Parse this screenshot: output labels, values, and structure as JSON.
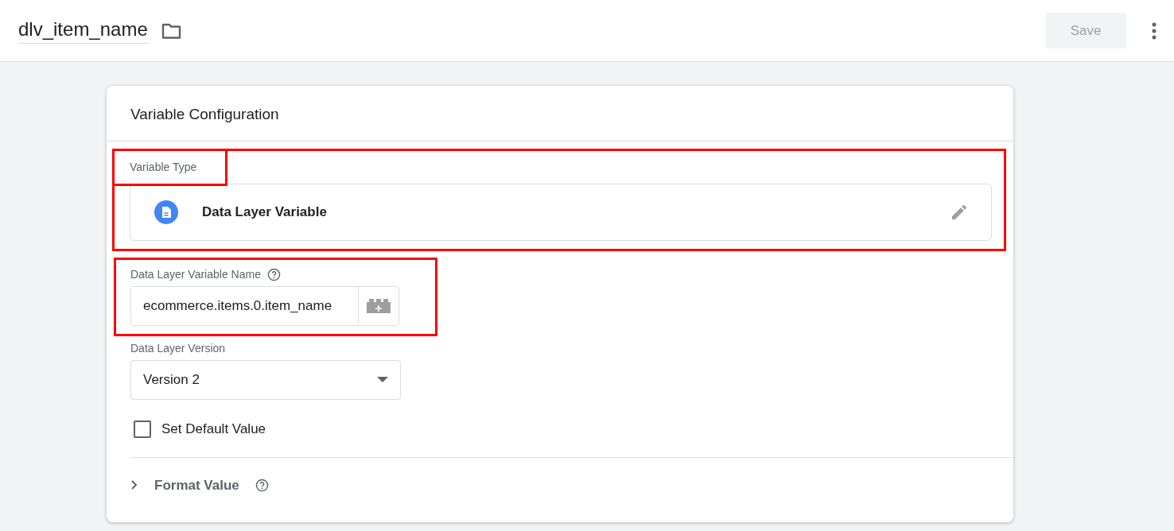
{
  "header": {
    "title": "dlv_item_name",
    "save_button": {
      "label": "Save",
      "disabled": true
    }
  },
  "card": {
    "title": "Variable Configuration"
  },
  "variable_type": {
    "label": "Variable Type",
    "value": "Data Layer Variable",
    "highlighted": true,
    "label_highlighted": true
  },
  "variable_name": {
    "label": "Data Layer Variable Name",
    "value": "ecommerce.items.0.item_name",
    "highlighted": true
  },
  "version": {
    "label": "Data Layer Version",
    "value": "Version 2"
  },
  "default_value": {
    "label": "Set Default Value",
    "checked": false
  },
  "format_value": {
    "label": "Format Value",
    "expanded": false
  }
}
